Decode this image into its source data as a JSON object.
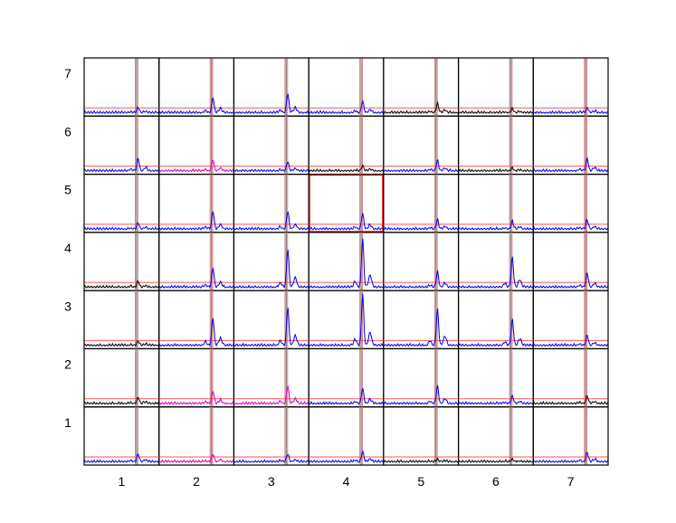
{
  "chart_data": {
    "type": "line",
    "title": "",
    "xlabel": "",
    "ylabel": "",
    "x_ticks": [
      "1",
      "2",
      "3",
      "4",
      "5",
      "6",
      "7"
    ],
    "y_ticks": [
      "1",
      "2",
      "3",
      "4",
      "5",
      "6",
      "7"
    ],
    "grid_size": [
      7,
      7
    ],
    "selected_cell": [
      4,
      5
    ],
    "grid": false,
    "legend": "none",
    "colors": {
      "blue": "#0000ee",
      "magenta": "#cc00cc",
      "black": "#000000",
      "threshold": "#ff5555",
      "marker_outer": "#d98080",
      "marker_inner": "#8a8a8a",
      "highlight_border": "#ff0000"
    },
    "peak_heights": [
      [
        0.1,
        0.3,
        0.38,
        0.22,
        0.18,
        0.08,
        0.1
      ],
      [
        0.25,
        0.22,
        0.18,
        0.1,
        0.2,
        0.05,
        0.25
      ],
      [
        0.12,
        0.35,
        0.35,
        0.3,
        0.18,
        0.15,
        0.18
      ],
      [
        0.12,
        0.38,
        0.75,
        0.95,
        0.3,
        0.6,
        0.28
      ],
      [
        0.08,
        0.55,
        0.75,
        1.0,
        0.72,
        0.52,
        0.2
      ],
      [
        0.12,
        0.25,
        0.35,
        0.3,
        0.35,
        0.15,
        0.15
      ],
      [
        0.15,
        0.15,
        0.15,
        0.2,
        0.05,
        0.05,
        0.18
      ]
    ],
    "curve_colors": [
      [
        "blue",
        "blue",
        "blue",
        "blue",
        "black",
        "black",
        "blue"
      ],
      [
        "blue",
        "magenta",
        "blue",
        "black",
        "blue",
        "black",
        "blue"
      ],
      [
        "blue",
        "blue",
        "blue",
        "blue",
        "blue",
        "blue",
        "blue"
      ],
      [
        "black",
        "blue",
        "blue",
        "blue",
        "blue",
        "blue",
        "blue"
      ],
      [
        "black",
        "blue",
        "blue",
        "blue",
        "blue",
        "blue",
        "blue"
      ],
      [
        "black",
        "magenta",
        "magenta",
        "blue",
        "blue",
        "blue",
        "black"
      ],
      [
        "blue",
        "magenta",
        "blue",
        "blue",
        "black",
        "black",
        "blue"
      ]
    ]
  }
}
